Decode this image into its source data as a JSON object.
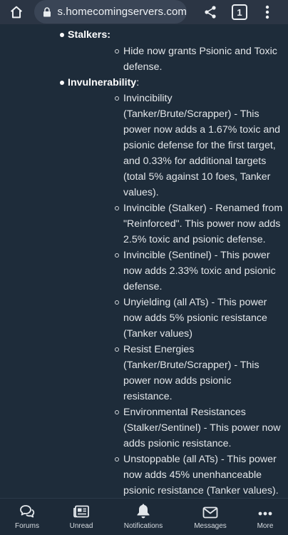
{
  "browser": {
    "url": "s.homecomingservers.com",
    "tab_count": "1",
    "icons": [
      "home-icon",
      "lock-icon",
      "share-icon",
      "tabs-icon",
      "kebab-menu-icon"
    ]
  },
  "content": {
    "sections": [
      {
        "heading": "Stalkers:",
        "items": [
          {
            "lines": [
              "Hide now grants Psionic and Toxic",
              "defense."
            ]
          }
        ]
      },
      {
        "heading": "Invulnerability",
        "colon": ":",
        "items": [
          {
            "lines": [
              "Invincibility",
              "(Tanker/Brute/Scrapper) - This",
              "power now adds a 1.67% toxic and",
              "psionic defense for the first target,",
              "and 0.33% for additional targets",
              "(total 5% against 10 foes, Tanker",
              "values)."
            ]
          },
          {
            "lines": [
              "Invincible (Stalker) - Renamed from",
              "\"Reinforced\". This power now adds",
              "2.5% toxic and psionic defense."
            ]
          },
          {
            "lines": [
              "Invincible (Sentinel) - This power",
              "now adds 2.33% toxic and psionic",
              "defense."
            ]
          },
          {
            "lines": [
              "Unyielding (all ATs) - This power",
              "now adds 5% psionic resistance",
              "(Tanker values)"
            ]
          },
          {
            "lines": [
              "Resist Energies",
              "(Tanker/Brute/Scrapper) - This",
              "power now adds psionic",
              "resistance."
            ]
          },
          {
            "lines": [
              "Environmental Resistances",
              "(Stalker/Sentinel) - This power now",
              "adds psionic resistance."
            ]
          },
          {
            "lines": [
              "Unstoppable (all ATs) - This power",
              "now adds 45% unenhanceable",
              "psionic resistance (Tanker values)."
            ]
          }
        ]
      }
    ]
  },
  "bottom_nav": {
    "items": [
      {
        "label": "Forums",
        "icon": "forums-icon"
      },
      {
        "label": "Unread",
        "icon": "newspaper-icon"
      },
      {
        "label": "Notifications",
        "icon": "bell-icon"
      },
      {
        "label": "Messages",
        "icon": "envelope-icon"
      },
      {
        "label": "More",
        "icon": "more-dots-icon"
      }
    ]
  }
}
